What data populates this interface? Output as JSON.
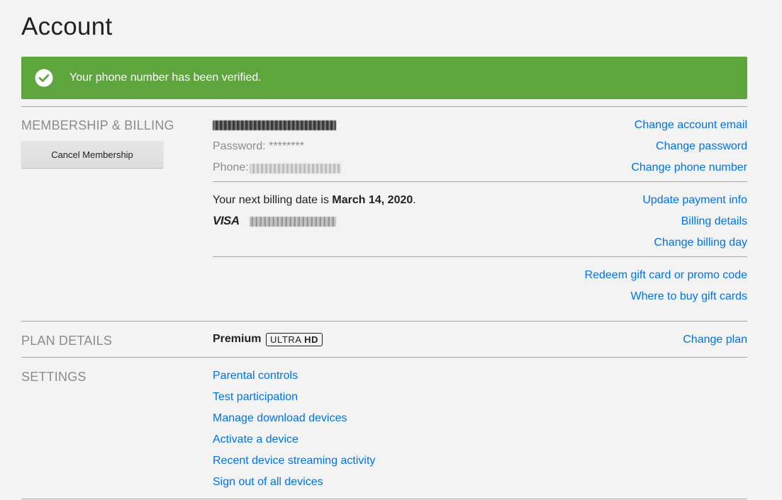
{
  "page": {
    "title": "Account"
  },
  "banner": {
    "message": "Your phone number has been verified.",
    "color": "#5ea53d",
    "icon": "check-circle-icon"
  },
  "membership": {
    "section_label": "MEMBERSHIP & BILLING",
    "cancel_button": "Cancel Membership",
    "password_label": "Password: ********",
    "phone_label": "Phone:",
    "billing_prefix": "Your next billing date is ",
    "billing_date": "March 14, 2020",
    "billing_suffix": ".",
    "card_brand": "VISA",
    "links": {
      "change_email": "Change account email",
      "change_password": "Change password",
      "change_phone": "Change phone number",
      "update_payment": "Update payment info",
      "billing_details": "Billing details",
      "change_billing_day": "Change billing day",
      "redeem_gift": "Redeem gift card or promo code",
      "where_buy_gift": "Where to buy gift cards"
    }
  },
  "plan": {
    "section_label": "PLAN DETAILS",
    "name": "Premium",
    "badge_light": "ULTRA",
    "badge_bold": "HD",
    "change_link": "Change plan"
  },
  "settings": {
    "section_label": "SETTINGS",
    "links": [
      "Parental controls",
      "Test participation",
      "Manage download devices",
      "Activate a device",
      "Recent device streaming activity",
      "Sign out of all devices"
    ]
  },
  "colors": {
    "link": "#0073e6",
    "muted": "#8c8c8c",
    "background": "#f3f3f3"
  }
}
